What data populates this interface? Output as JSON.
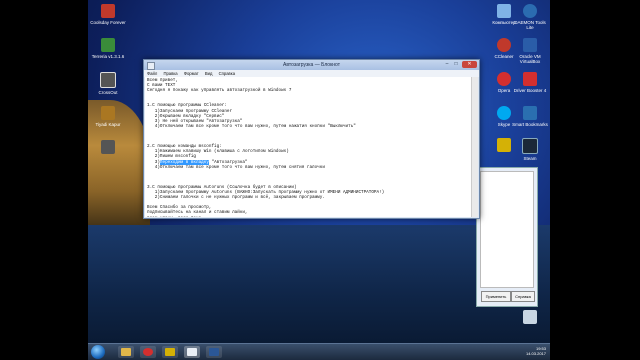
{
  "desktop_icons": [
    {
      "label": "Coolsday Forever",
      "color": "#c0392b"
    },
    {
      "label": "Terreria v1.3.1.6",
      "color": "#3a8c3a"
    },
    {
      "label": "CrossOut",
      "color": "#555555"
    },
    {
      "label": "Tiyadi Kapur",
      "color": "#aa7722"
    },
    {
      "label": "Компьютер",
      "color": "#7fb3e6"
    },
    {
      "label": "DAEMON Tools Lite",
      "color": "#2b6cb0"
    },
    {
      "label": "CCleaner",
      "color": "#c0392b"
    },
    {
      "label": "Oracle VM VirtualBox",
      "color": "#2a5da8"
    },
    {
      "label": "Opera",
      "color": "#d32f2f"
    },
    {
      "label": "Driver Booster 4",
      "color": "#d32f2f"
    },
    {
      "label": "Skype",
      "color": "#00a9f0"
    },
    {
      "label": "Smart Bookmarks",
      "color": "#2a6fb0"
    },
    {
      "label": "ХВ",
      "color": "#d4b106"
    },
    {
      "label": "Steam",
      "color": "#1b2838"
    }
  ],
  "notepad": {
    "title": "Автозагрузка — Блокнот",
    "menu": [
      "Файл",
      "Правка",
      "Формат",
      "Вид",
      "Справка"
    ],
    "lines": [
      "Всем привет,",
      "С вами TEXT",
      "Сегодня я покажу как управлять автозагрузкой в Windows 7",
      "",
      "",
      "1.С помощью программы CCleaner:",
      "   1)Запускаем программу CCleaner",
      "   2)Окрываем вкладку \"Сервис\"",
      "   3) Не ней открываем \"Автозагрузка\"",
      "   4)Отключаем там все кроме того что вам нужно, путем нажатия кнопки \"Выключить\"",
      "",
      "",
      "",
      "2.С помощью команды msconfig:",
      "   1)Нажимаем клавишу Win (клавиша с логотипом Windows)",
      "   2)Пишем msconfig",
      "   3)Переходим в вкладку \"Автозагрузка\"",
      "   4)Отключаем там все кроме того что вам нужно, путем снятия галочки",
      "",
      "",
      "",
      "3.С помощью программы Autoruns (Ссылочка будет в описании)",
      "   1)Запускаем программу Autoruns (ВАЖНО:Запускать программу нужно от ИМЕНИ АДМИНИСТРАТОРА!)",
      "   2)Снимаем галочки с не нужных программ и всё, закрываем программу.",
      "",
      "Всем Спасибо за просмотр,",
      "подписывайтесь на канал и ставим лайки,",
      "всем удачи, всем пока..."
    ],
    "selected_text": "Переходим в вкладку"
  },
  "dialog": {
    "button1": "Применить",
    "button2": "Справка"
  },
  "taskbar": {
    "items": [
      {
        "name": "explorer",
        "color": "#e0b64a"
      },
      {
        "name": "opera",
        "color": "#d32f2f"
      },
      {
        "name": "media",
        "color": "#d4b106"
      },
      {
        "name": "notepad",
        "color": "#e9eef5"
      },
      {
        "name": "word",
        "color": "#2b5797"
      }
    ],
    "time": "19:53",
    "date": "14.03.2017"
  }
}
